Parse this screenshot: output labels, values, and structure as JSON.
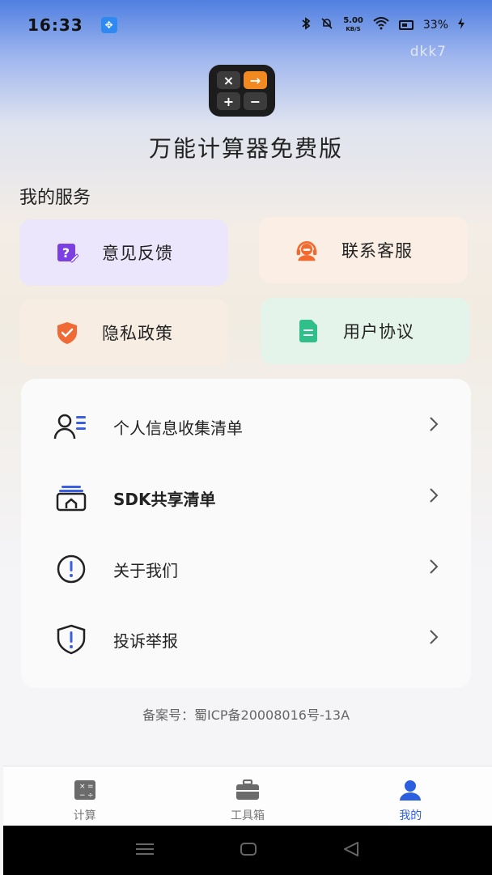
{
  "status": {
    "time": "16:33",
    "net_speed_value": "5.00",
    "net_speed_unit": "KB/S",
    "battery": "33%"
  },
  "watermark": "dkk7",
  "app": {
    "title": "万能计算器免费版",
    "logo_symbols": [
      "×",
      "→",
      "+",
      "−"
    ]
  },
  "services": {
    "title": "我的服务",
    "items": [
      {
        "label": "意见反馈",
        "icon": "feedback-icon",
        "color": "#7b3fe4"
      },
      {
        "label": "联系客服",
        "icon": "customer-service-icon",
        "color": "#f26a2e"
      },
      {
        "label": "隐私政策",
        "icon": "shield-icon",
        "color": "#f06a35"
      },
      {
        "label": "用户协议",
        "icon": "document-icon",
        "color": "#2fbf8a"
      }
    ]
  },
  "list": {
    "items": [
      {
        "label": "个人信息收集清单",
        "icon": "personal-info-icon"
      },
      {
        "label": "SDK共享清单",
        "icon": "sdk-share-icon"
      },
      {
        "label": "关于我们",
        "icon": "info-icon"
      },
      {
        "label": "投诉举报",
        "icon": "report-shield-icon"
      }
    ]
  },
  "icp": "备案号：蜀ICP备20008016号-13A",
  "tabs": [
    {
      "label": "计算",
      "icon": "calculator-icon",
      "active": false
    },
    {
      "label": "工具箱",
      "icon": "toolbox-icon",
      "active": false
    },
    {
      "label": "我的",
      "icon": "profile-icon",
      "active": true
    }
  ],
  "colors": {
    "accent": "#2b5fe0",
    "text": "#222222"
  }
}
